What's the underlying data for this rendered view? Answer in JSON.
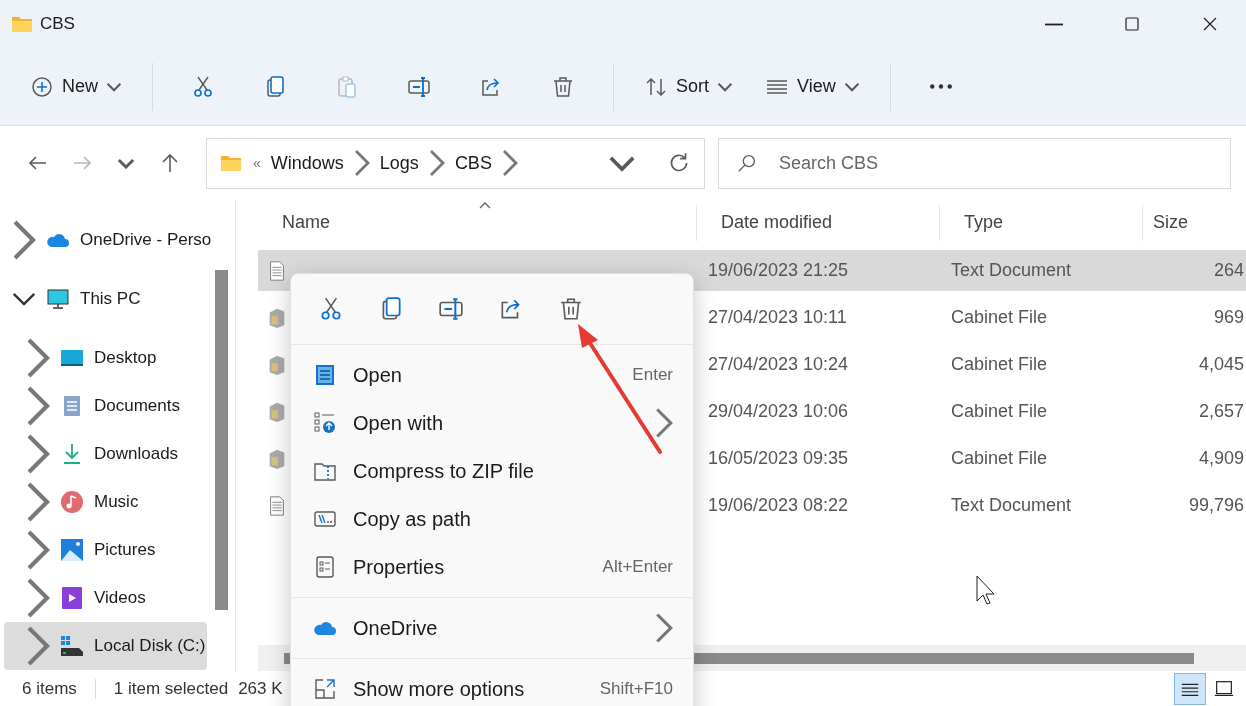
{
  "window": {
    "title": "CBS"
  },
  "toolbar": [
    {
      "kind": "new",
      "label": "New",
      "disabled": false
    },
    {
      "kind": "cut",
      "disabled": false
    },
    {
      "kind": "copy",
      "disabled": false
    },
    {
      "kind": "paste",
      "disabled": true
    },
    {
      "kind": "rename",
      "disabled": false
    },
    {
      "kind": "share",
      "disabled": false
    },
    {
      "kind": "delete",
      "disabled": false
    },
    {
      "kind": "sort",
      "label": "Sort",
      "disabled": false
    },
    {
      "kind": "view",
      "label": "View",
      "disabled": false
    },
    {
      "kind": "more",
      "disabled": false
    }
  ],
  "nav_buttons": [
    {
      "kind": "back",
      "disabled": false
    },
    {
      "kind": "forward",
      "disabled": true
    },
    {
      "kind": "recent",
      "disabled": false
    },
    {
      "kind": "up",
      "disabled": false
    }
  ],
  "address": {
    "overflow": "«",
    "path": [
      "Windows",
      "Logs",
      "CBS"
    ]
  },
  "search": {
    "placeholder": "Search CBS"
  },
  "sidebar": {
    "items": [
      {
        "label": "OneDrive - Perso",
        "kind": "cloud",
        "expanded": false,
        "selected": false
      },
      {
        "label": "This PC",
        "kind": "monitor",
        "expanded": true,
        "selected": false,
        "children": [
          {
            "label": "Desktop",
            "kind": "desktop",
            "expanded": false,
            "selected": false
          },
          {
            "label": "Documents",
            "kind": "documents",
            "expanded": false,
            "selected": false
          },
          {
            "label": "Downloads",
            "kind": "download",
            "expanded": false,
            "selected": false
          },
          {
            "label": "Music",
            "kind": "music",
            "expanded": false,
            "selected": false
          },
          {
            "label": "Pictures",
            "kind": "pictures",
            "expanded": false,
            "selected": false
          },
          {
            "label": "Videos",
            "kind": "videos",
            "expanded": false,
            "selected": false
          },
          {
            "label": "Local Disk (C:)",
            "kind": "disk",
            "expanded": false,
            "selected": true
          }
        ]
      }
    ]
  },
  "table": {
    "columns": [
      "Name",
      "Date modified",
      "Type",
      "Size"
    ],
    "rows": [
      {
        "kind": "text",
        "date": "19/06/2023 21:25",
        "type": "Text Document",
        "size": "264",
        "selected": true
      },
      {
        "kind": "cabinet",
        "date": "27/04/2023 10:11",
        "type": "Cabinet File",
        "size": "969",
        "selected": false
      },
      {
        "kind": "cabinet",
        "date": "27/04/2023 10:24",
        "type": "Cabinet File",
        "size": "4,045",
        "selected": false
      },
      {
        "kind": "cabinet",
        "date": "29/04/2023 10:06",
        "type": "Cabinet File",
        "size": "2,657",
        "selected": false
      },
      {
        "kind": "cabinet",
        "date": "16/05/2023 09:35",
        "type": "Cabinet File",
        "size": "4,909",
        "selected": false
      },
      {
        "kind": "text",
        "date": "19/06/2023 08:22",
        "type": "Text Document",
        "size": "99,796",
        "selected": false
      }
    ]
  },
  "context_menu": {
    "quick_actions": [
      {
        "kind": "cut"
      },
      {
        "kind": "copy"
      },
      {
        "kind": "rename"
      },
      {
        "kind": "share"
      },
      {
        "kind": "delete"
      }
    ],
    "sections": [
      [
        {
          "kind": "open",
          "label": "Open",
          "shortcut": "Enter",
          "submenu": false
        },
        {
          "kind": "openwith",
          "label": "Open with",
          "submenu": true
        },
        {
          "kind": "zip",
          "label": "Compress to ZIP file",
          "submenu": false
        },
        {
          "kind": "path",
          "label": "Copy as path",
          "submenu": false
        },
        {
          "kind": "properties",
          "label": "Properties",
          "shortcut": "Alt+Enter",
          "submenu": false
        }
      ],
      [
        {
          "kind": "cloud",
          "label": "OneDrive",
          "submenu": true
        }
      ],
      [
        {
          "kind": "more",
          "label": "Show more options",
          "shortcut": "Shift+F10",
          "submenu": false
        }
      ]
    ]
  },
  "status_bar": {
    "count": "6 items",
    "selection": "1 item selected",
    "size": "263 K"
  },
  "view_buttons": [
    {
      "kind": "details",
      "selected": true
    },
    {
      "kind": "tiles",
      "selected": false
    }
  ]
}
